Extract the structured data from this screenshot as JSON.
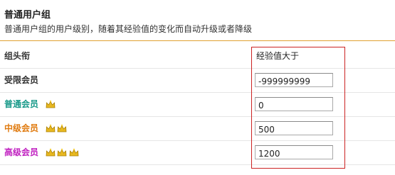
{
  "section": {
    "title": "普通用户组",
    "description": "普通用户组的用户级别，随着其经验值的变化而自动升级或者降级"
  },
  "table": {
    "col_group_head": "组头衔",
    "col_exp_head": "经验值大于",
    "rows": [
      {
        "name": "受限会员",
        "color": "#333333",
        "crowns": 0,
        "value": "-999999999"
      },
      {
        "name": "普通会员",
        "color": "#1a9a8a",
        "crowns": 1,
        "value": "0"
      },
      {
        "name": "中级会员",
        "color": "#e07b10",
        "crowns": 2,
        "value": "500"
      },
      {
        "name": "高级会员",
        "color": "#c020c0",
        "crowns": 3,
        "value": "1200"
      }
    ]
  },
  "icons": {
    "crown": "crown-icon"
  },
  "colors": {
    "crown": "#e8b820",
    "divider": "#e0a030",
    "highlight_box": "#cc2222"
  }
}
